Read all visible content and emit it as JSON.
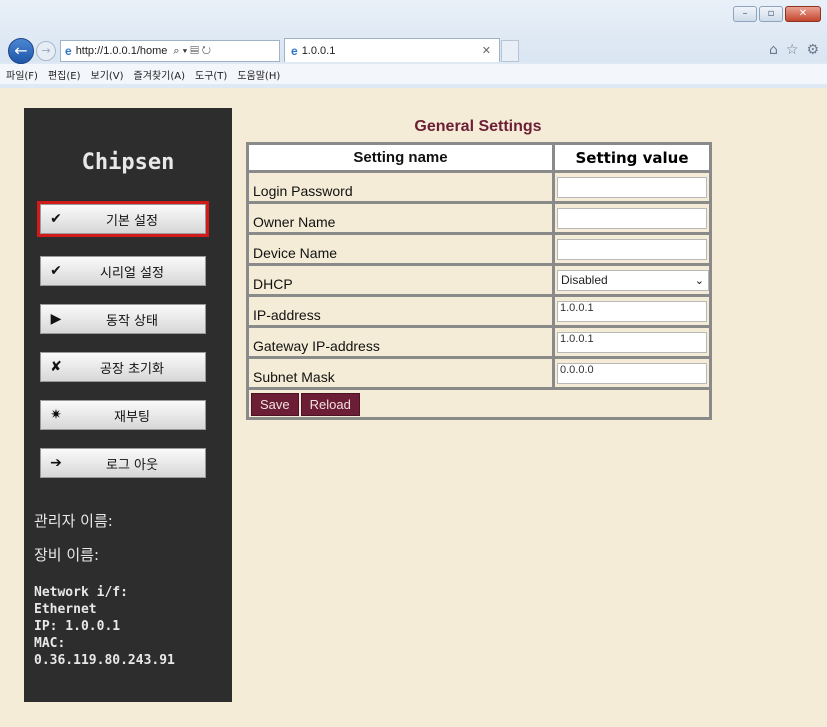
{
  "browser": {
    "url": "http://1.0.0.1/home",
    "tab_title": "1.0.0.1",
    "menu": [
      "파일(F)",
      "편집(E)",
      "보기(V)",
      "즐겨찾기(A)",
      "도구(T)",
      "도움말(H)"
    ]
  },
  "sidebar": {
    "brand": "Chipsen",
    "buttons": [
      {
        "label": "기본 설정",
        "icon": "check-icon",
        "glyph": "✔"
      },
      {
        "label": "시리얼 설정",
        "icon": "check-icon",
        "glyph": "✔"
      },
      {
        "label": "동작 상태",
        "icon": "play-icon",
        "glyph": "▶"
      },
      {
        "label": "공장 초기화",
        "icon": "x-icon",
        "glyph": "✘"
      },
      {
        "label": "재부팅",
        "icon": "burst-icon",
        "glyph": "✷"
      },
      {
        "label": "로그 아웃",
        "icon": "arrow-right-icon",
        "glyph": "➔"
      }
    ],
    "admin_label": "관리자 이름:",
    "device_label": "장비 이름:",
    "network": {
      "iface_label": "Network i/f:",
      "iface": "Ethernet",
      "ip": "IP: 1.0.0.1",
      "mac_label": "MAC:",
      "mac": "0.36.119.80.243.91"
    },
    "active_color": "#d11a1a"
  },
  "settings": {
    "title": "General Settings",
    "header_name": "Setting name",
    "header_value": "Setting value",
    "rows": [
      {
        "name": "Login Password",
        "value": ""
      },
      {
        "name": "Owner Name",
        "value": ""
      },
      {
        "name": "Device Name",
        "value": ""
      },
      {
        "name": "DHCP",
        "value": "Disabled"
      },
      {
        "name": "IP-address",
        "value": "1.0.0.1"
      },
      {
        "name": "Gateway IP-address",
        "value": "1.0.0.1"
      },
      {
        "name": "Subnet Mask",
        "value": "0.0.0.0"
      }
    ],
    "save_label": "Save",
    "reload_label": "Reload",
    "accent": "#6b1e35"
  }
}
